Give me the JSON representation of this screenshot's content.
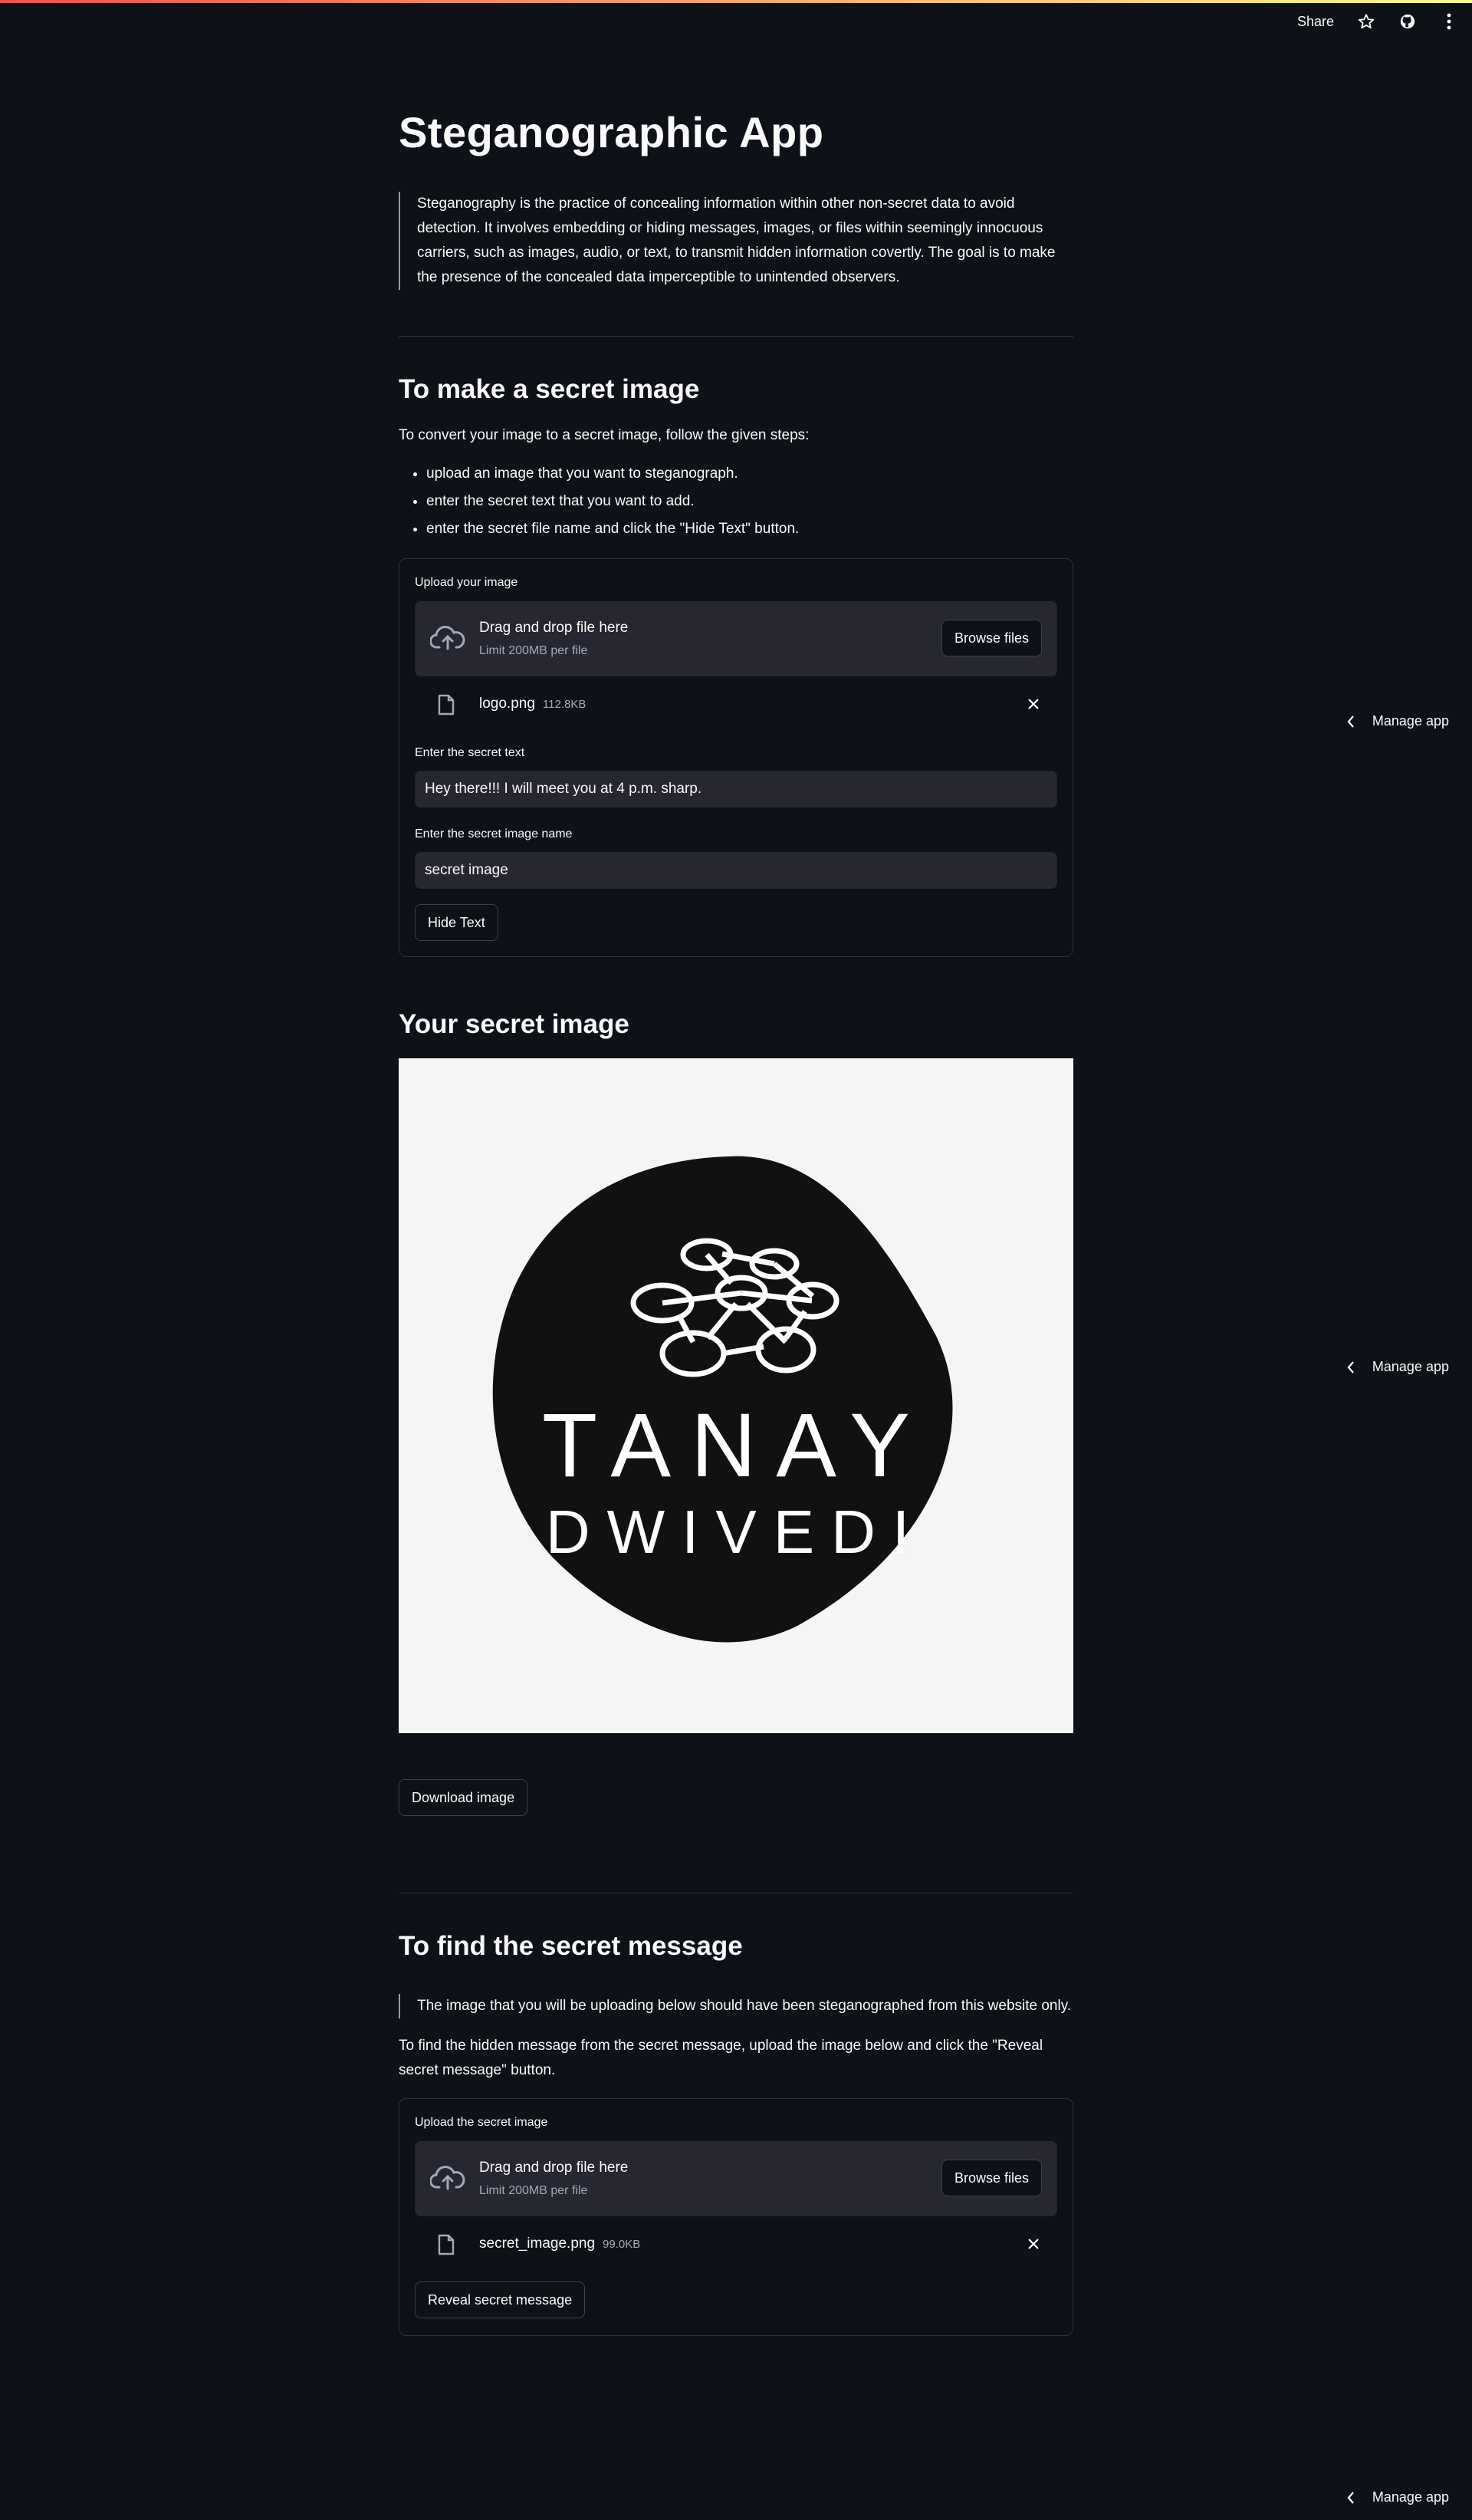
{
  "header": {
    "share_label": "Share",
    "star_icon": "star-icon",
    "github_icon": "github-icon",
    "menu_icon": "more-vertical-icon"
  },
  "manage_app": {
    "label": "Manage app",
    "icon": "chevron-left-icon"
  },
  "title": "Steganographic App",
  "intro": "Steganography is the practice of concealing information within other non-secret data to avoid detection. It involves embedding or hiding messages, images, or files within seemingly innocuous carriers, such as images, audio, or text, to transmit hidden information covertly. The goal is to make the presence of the concealed data imperceptible to unintended observers.",
  "make_section": {
    "heading": "To make a secret image",
    "instructions": "To convert your image to a secret image, follow the given steps:",
    "steps": [
      "upload an image that you want to steganograph.",
      "enter the secret text that you want to add.",
      "enter the secret file name and click the \"Hide Text\" button."
    ],
    "upload_label": "Upload your image",
    "dropzone_title": "Drag and drop file here",
    "dropzone_limit": "Limit 200MB per file",
    "browse_label": "Browse files",
    "file_name": "logo.png",
    "file_size": "112.8KB",
    "secret_text_label": "Enter the secret text",
    "secret_text_value": "Hey there!!! I will meet you at 4 p.m. sharp.",
    "image_name_label": "Enter the secret image name",
    "image_name_value": "secret image",
    "hide_button": "Hide Text"
  },
  "result_section": {
    "heading": "Your secret image",
    "logo_line1": "TANAY",
    "logo_line2": "DWIVEDI",
    "download_button": "Download image"
  },
  "find_section": {
    "heading": "To find the secret message",
    "note": "The image that you will be uploading below should have been steganographed from this website only.",
    "instructions": "To find the hidden message from the secret message, upload the image below and click the \"Reveal secret message\" button.",
    "upload_label": "Upload the secret image",
    "dropzone_title": "Drag and drop file here",
    "dropzone_limit": "Limit 200MB per file",
    "browse_label": "Browse files",
    "file_name": "secret_image.png",
    "file_size": "99.0KB",
    "reveal_button": "Reveal secret message"
  },
  "colors": {
    "background": "#0e1117",
    "surface": "#262730",
    "border": "#31333f",
    "accent_gradient_start": "#ff4b4b",
    "accent_gradient_end": "#fffd80"
  }
}
